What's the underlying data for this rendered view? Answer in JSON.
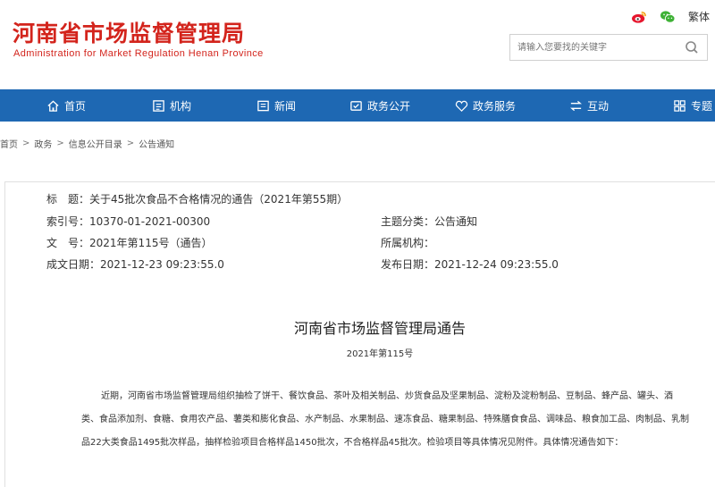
{
  "header": {
    "logo_cn": "河南省市场监督管理局",
    "logo_en": "Administration for Market Regulation Henan Province",
    "traditional": "繁体",
    "search_placeholder": "请输入您要找的关键字"
  },
  "nav": {
    "items": [
      {
        "label": "首页",
        "icon": "home-icon"
      },
      {
        "label": "机构",
        "icon": "org-icon"
      },
      {
        "label": "新闻",
        "icon": "news-icon"
      },
      {
        "label": "政务公开",
        "icon": "gov-open-icon"
      },
      {
        "label": "政务服务",
        "icon": "heart-icon"
      },
      {
        "label": "互动",
        "icon": "interact-icon"
      },
      {
        "label": "专题",
        "icon": "topic-icon"
      }
    ]
  },
  "breadcrumb": [
    "首页",
    "政务",
    "信息公开目录",
    "公告通知"
  ],
  "meta": {
    "title_label": "标　题：",
    "title_value": "关于45批次食品不合格情况的通告（2021年第55期）",
    "index_label": "索引号：",
    "index_value": "10370-01-2021-00300",
    "category_label": "主题分类：",
    "category_value": "公告通知",
    "doc_no_label": "文　号：",
    "doc_no_value": "2021年第115号（通告）",
    "org_label": "所属机构：",
    "org_value": "",
    "created_label": "成文日期：",
    "created_value": "2021-12-23 09:23:55.0",
    "published_label": "发布日期：",
    "published_value": "2021-12-24 09:23:55.0"
  },
  "document": {
    "heading": "河南省市场监督管理局通告",
    "number": "2021年第115号",
    "body": "近期，河南省市场监督管理局组织抽检了饼干、餐饮食品、茶叶及相关制品、炒货食品及坚果制品、淀粉及淀粉制品、豆制品、蜂产品、罐头、酒类、食品添加剂、食糖、食用农产品、薯类和膨化食品、水产制品、水果制品、速冻食品、糖果制品、特殊膳食食品、调味品、粮食加工品、肉制品、乳制品22大类食品1495批次样品，抽样检验项目合格样品1450批次，不合格样品45批次。检验项目等具体情况见附件。具体情况通告如下："
  },
  "colors": {
    "brand_red": "#d3241c",
    "nav_blue": "#1e68b3"
  }
}
